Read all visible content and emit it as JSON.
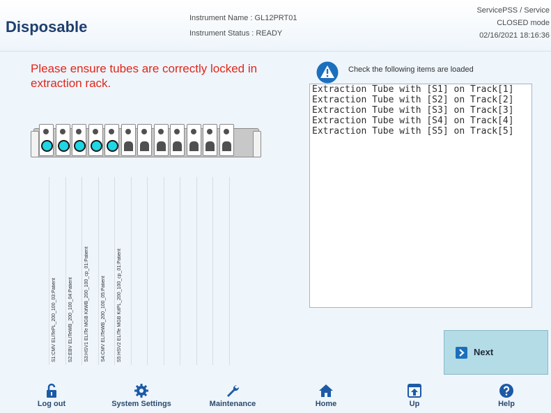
{
  "header": {
    "title": "Disposable",
    "instrument_name": "Instrument Name : GL12PRT01",
    "instrument_status": "Instrument Status : READY",
    "user": "ServicePSS / Service",
    "mode": "CLOSED mode",
    "datetime": "02/16/2021 18:16:36"
  },
  "main": {
    "warning": "Please ensure tubes are correctly locked in extraction rack.",
    "rack": {
      "slot_count": 12,
      "loaded_slots": [
        1,
        2,
        3,
        4,
        5
      ],
      "tube_color": "#1fd7e4"
    },
    "sample_labels": [
      "S1:CMV ELITePL_200_100_03:Patient",
      "S2:EBV ELITeWB_200_100_04:Patient",
      "S3:HSV1 ELITe MGB KitWB_200_100_cp_01:Patient",
      "S4:CMV ELITeWB_200_100_05:Patient",
      "S5:HSV2 ELITe MGB KitPL_200_100_cp_01:Patient"
    ],
    "check_text": "Check the following items are loaded",
    "items": [
      "Extraction Tube with [S1] on Track[1]",
      "Extraction Tube with [S2] on Track[2]",
      "Extraction Tube with [S3] on Track[3]",
      "Extraction Tube with [S4] on Track[4]",
      "Extraction Tube with [S5] on Track[5]"
    ],
    "next_label": "Next"
  },
  "footer": {
    "logout": "Log out",
    "system_settings": "System Settings",
    "maintenance": "Maintenance",
    "home": "Home",
    "up": "Up",
    "help": "Help"
  },
  "colors": {
    "accent": "#1c6fbd",
    "warning_text": "#e0261b",
    "background": "#eef5fb"
  }
}
